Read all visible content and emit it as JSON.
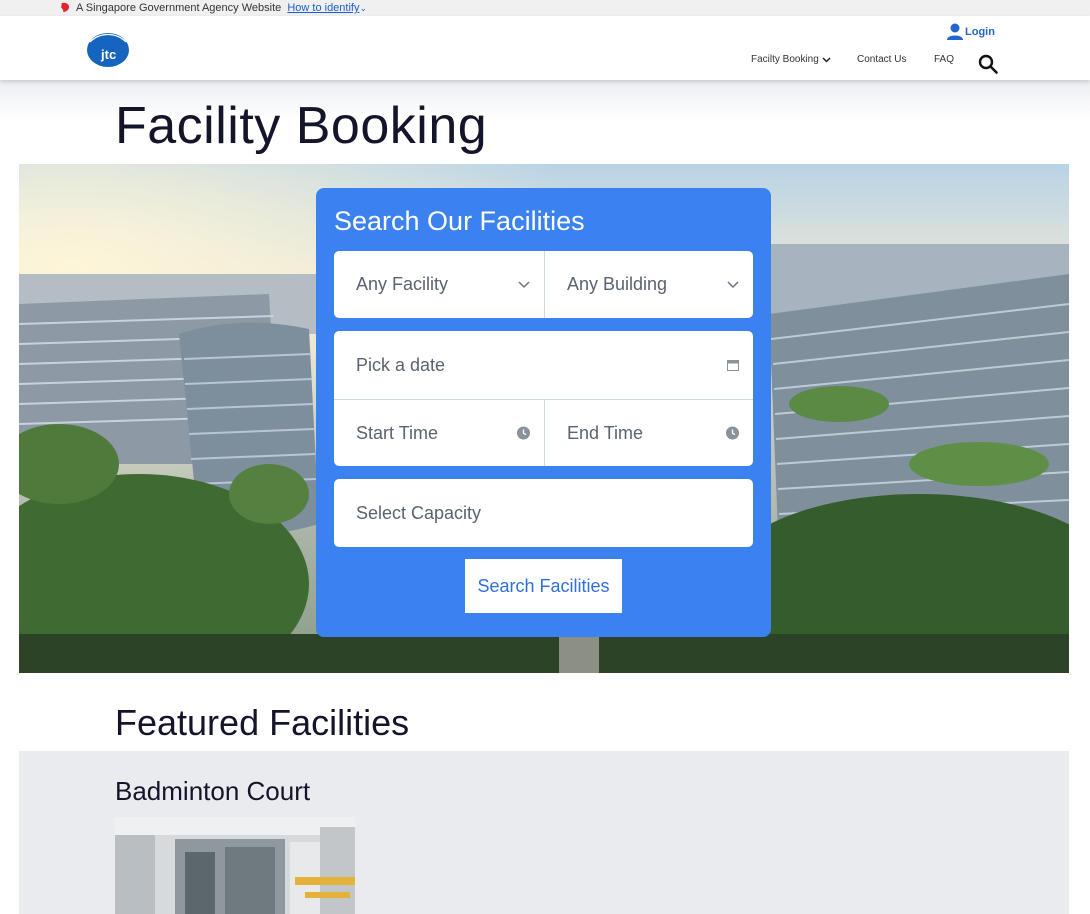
{
  "masthead": {
    "text": "A Singapore Government Agency Website",
    "link": "How to identify"
  },
  "header": {
    "logo_text": "jtc",
    "login_label": "Login",
    "nav": {
      "facility_booking": "Facilty Booking",
      "contact_us": "Contact Us",
      "faq": "FAQ"
    }
  },
  "page_title": "Facility Booking",
  "search_card": {
    "title": "Search Our Facilities",
    "facility_placeholder": "Any Facility",
    "building_placeholder": "Any Building",
    "date_placeholder": "Pick a date",
    "start_time_placeholder": "Start Time",
    "end_time_placeholder": "End Time",
    "capacity_placeholder": "Select Capacity",
    "search_button": "Search Facilities"
  },
  "featured": {
    "title": "Featured Facilities",
    "items": [
      {
        "name": "Badminton Court"
      }
    ]
  },
  "colors": {
    "card_blue": "#3b82f0",
    "link_blue": "#2264d1",
    "logo_blue": "#1565c0"
  }
}
